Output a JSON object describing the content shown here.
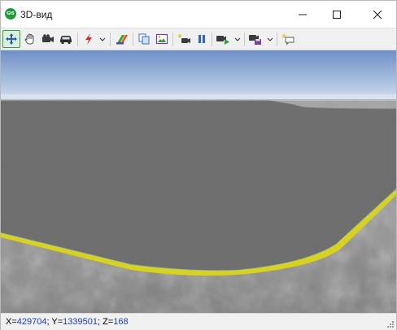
{
  "window": {
    "title": "3D-вид",
    "app_icon_text": "GIS"
  },
  "toolbar": {
    "buttons": [
      {
        "icon": "move-arrows-icon",
        "active": true
      },
      {
        "icon": "hand-pan-icon"
      },
      {
        "icon": "video-camera-icon"
      },
      {
        "icon": "car-icon"
      },
      {
        "icon": "lightning-icon",
        "has_dropdown": true
      },
      {
        "icon": "layers-palette-icon"
      },
      {
        "icon": "copy-icon"
      },
      {
        "icon": "image-icon"
      },
      {
        "icon": "new-camera-icon"
      },
      {
        "icon": "pause-icon"
      },
      {
        "icon": "camera-play-icon",
        "has_dropdown": true
      },
      {
        "icon": "save-camera-icon",
        "has_dropdown": true
      },
      {
        "icon": "new-comment-icon"
      }
    ]
  },
  "status": {
    "x_label": "X=",
    "x_value": "429704",
    "y_label": "; Y=",
    "y_value": "1339501",
    "z_label": "; Z=",
    "z_value": "168"
  },
  "colors": {
    "accent": "#2f9d3c",
    "sky_top": "#6f8fc7",
    "sky_horizon": "#e3ebf5",
    "plane": "#6d6d6d",
    "edge": "#d8d21c",
    "terrain": "#8a8a8a",
    "coord_value": "#1a3fb0"
  }
}
